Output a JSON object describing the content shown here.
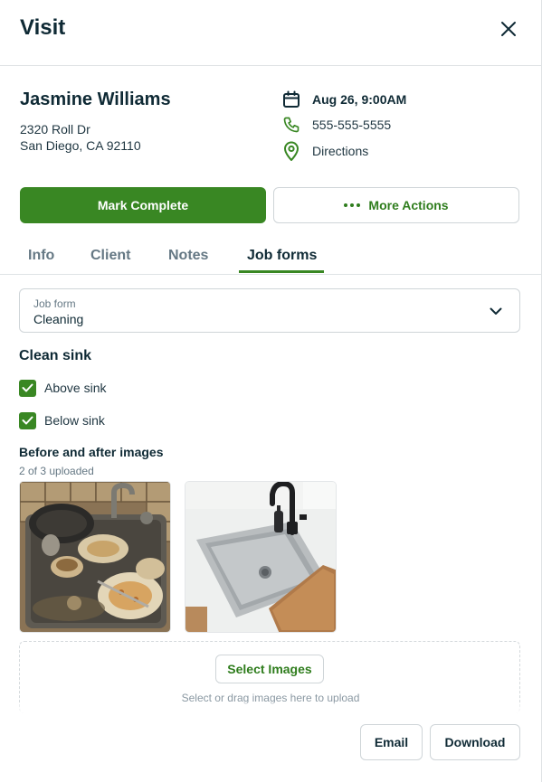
{
  "header": {
    "title": "Visit",
    "close_icon": "close-icon"
  },
  "client": {
    "name": "Jasmine Williams",
    "address_line1": "2320 Roll Dr",
    "address_line2": "San Diego, CA 92110"
  },
  "details": {
    "date": "Aug 26, 9:00AM",
    "phone": "555-555-5555",
    "directions": "Directions"
  },
  "actions": {
    "primary": "Mark Complete",
    "secondary": "More Actions"
  },
  "tabs": [
    {
      "label": "Info",
      "active": false
    },
    {
      "label": "Client",
      "active": false
    },
    {
      "label": "Notes",
      "active": false
    },
    {
      "label": "Job forms",
      "active": true
    }
  ],
  "job_form": {
    "label": "Job form",
    "value": "Cleaning"
  },
  "section": {
    "title": "Clean sink",
    "checks": [
      {
        "label": "Above sink",
        "checked": true
      },
      {
        "label": "Below sink",
        "checked": true
      }
    ]
  },
  "images": {
    "title": "Before and after images",
    "count": "2 of 3 uploaded",
    "select_button": "Select Images",
    "hint": "Select or drag images here to upload"
  },
  "footer": {
    "email": "Email",
    "download": "Download"
  },
  "colors": {
    "accent": "#398723",
    "text": "#0f2a35",
    "muted": "#657884",
    "border": "#cfd5d8"
  }
}
